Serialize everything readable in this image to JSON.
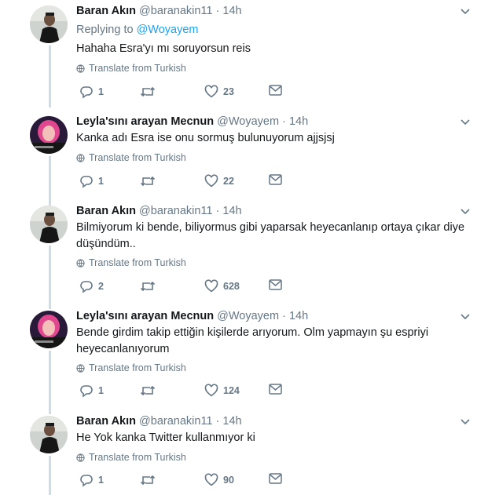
{
  "replying_label": "Replying to",
  "replying_mention": "@Woyayem",
  "translate_label": "Translate from Turkish",
  "tweets": [
    {
      "name": "Baran Akın",
      "handle": "@baranakin11",
      "separator": "·",
      "time": "14h",
      "text_lines": [
        "Hahaha Esra'yı mı soruyorsun reis"
      ],
      "replies": "1",
      "retweets": "",
      "likes": "23"
    },
    {
      "name": "Leyla'sını arayan Mecnun",
      "handle": "@Woyayem",
      "separator": "·",
      "time": "14h",
      "text_lines": [
        "Kanka adı Esra ise onu sormuş bulunuyorum ajjsjsj"
      ],
      "replies": "1",
      "retweets": "",
      "likes": "22"
    },
    {
      "name": "Baran Akın",
      "handle": "@baranakin11",
      "separator": "·",
      "time": "14h",
      "text_lines": [
        "Bilmiyorum ki bende, biliyormus gibi yaparsak heyecanlanıp ortaya çıkar diye",
        "düşündüm.."
      ],
      "replies": "2",
      "retweets": "",
      "likes": "628"
    },
    {
      "name": "Leyla'sını arayan Mecnun",
      "handle": "@Woyayem",
      "separator": "·",
      "time": "14h",
      "text_lines": [
        "Bende girdim takip ettiğin kişilerde arıyorum. Olm yapmayın şu espriyi",
        "heyecanlanıyorum"
      ],
      "replies": "1",
      "retweets": "",
      "likes": "124"
    },
    {
      "name": "Baran Akın",
      "handle": "@baranakin11",
      "separator": "·",
      "time": "14h",
      "text_lines": [
        "He Yok kanka Twitter kullanmıyor ki"
      ],
      "replies": "1",
      "retweets": "",
      "likes": "90"
    }
  ],
  "colors": {
    "accent": "#1da1f2",
    "secondary_text": "#657786",
    "thread_line": "#d3dbe2"
  }
}
